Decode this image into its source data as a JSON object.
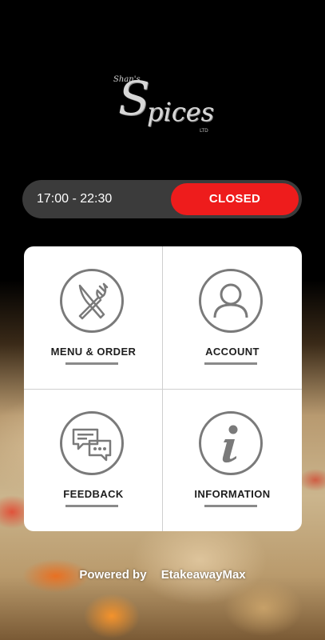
{
  "logo": {
    "prefix": "Shan's",
    "initial": "S",
    "rest": "pices",
    "suffix": "LTD"
  },
  "status": {
    "hours": "17:00 - 22:30",
    "state": "CLOSED"
  },
  "tiles": [
    {
      "label": "MENU & ORDER",
      "icon": "cutlery-icon"
    },
    {
      "label": "ACCOUNT",
      "icon": "user-icon"
    },
    {
      "label": "FEEDBACK",
      "icon": "chat-icon"
    },
    {
      "label": "INFORMATION",
      "icon": "info-icon"
    }
  ],
  "footer": {
    "powered": "Powered by",
    "brand": "EtakeawayMax"
  },
  "colors": {
    "closed_bg": "#ee1c1c",
    "status_bg": "#3b3b3b",
    "icon": "#7a7a7a"
  }
}
